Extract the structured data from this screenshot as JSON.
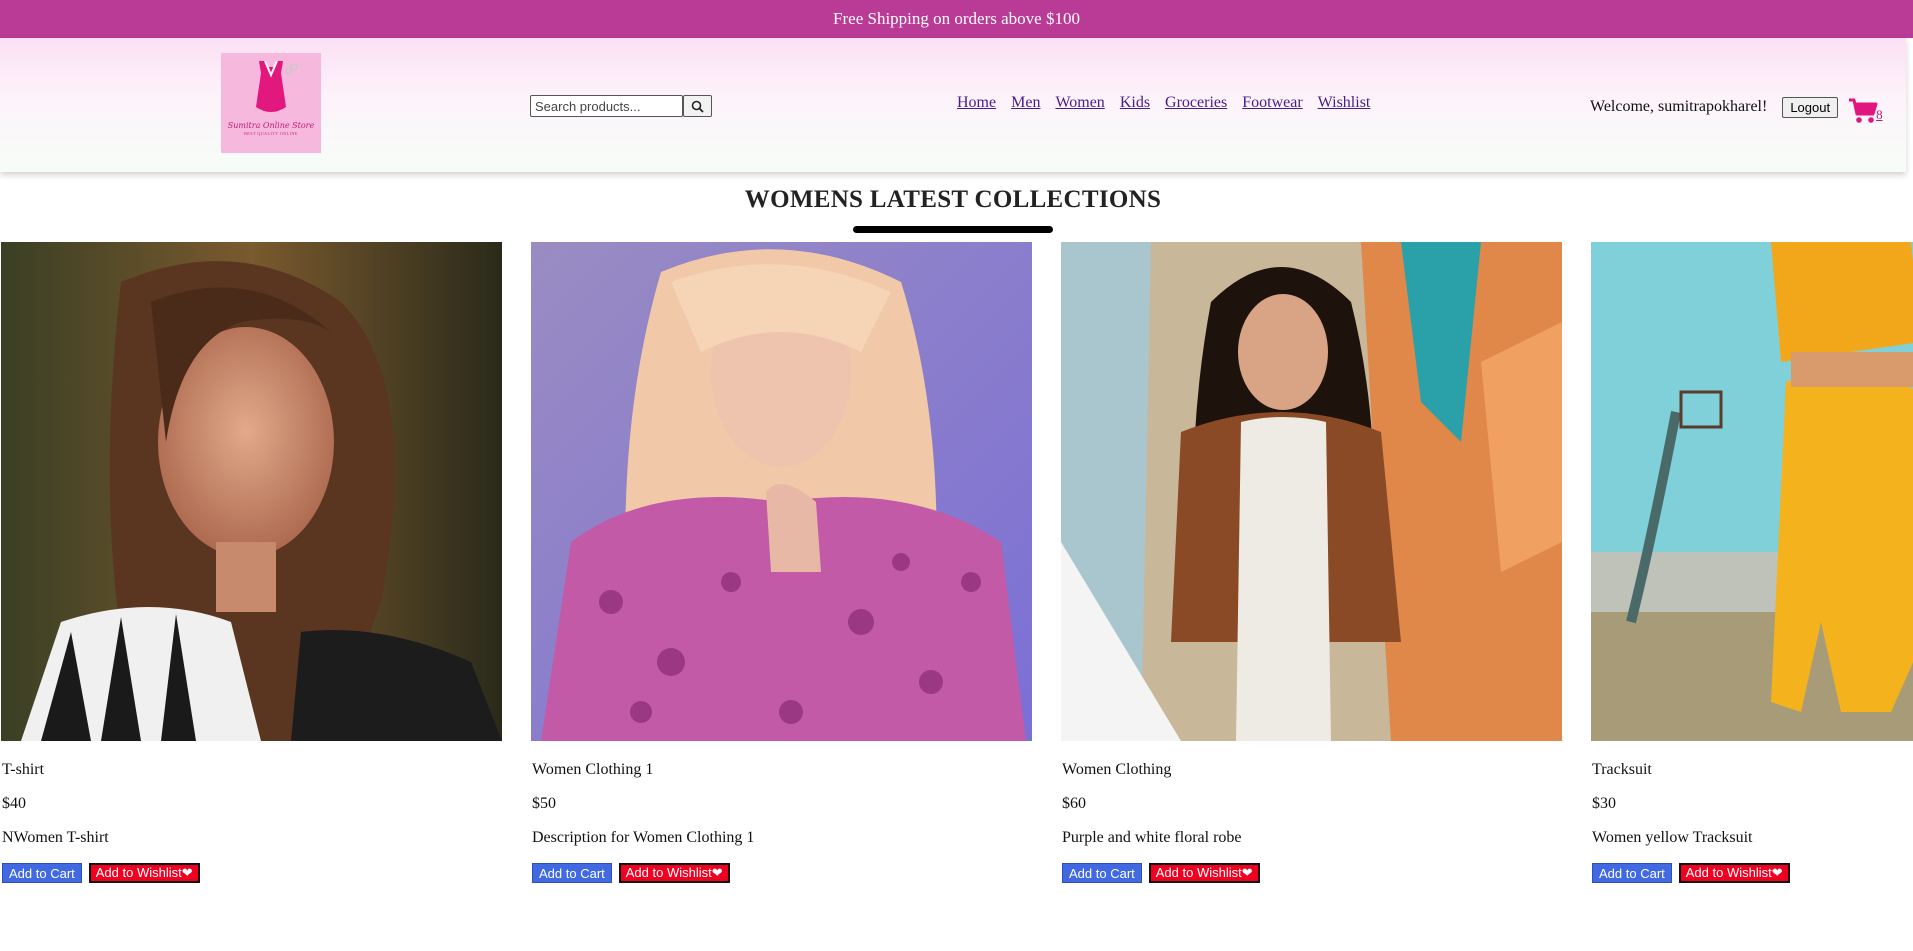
{
  "promo": {
    "text": "Free Shipping on orders above $100"
  },
  "logo": {
    "title": "Sumitra Online Store",
    "subtitle": "BEST QUALITY ONLINE"
  },
  "search": {
    "placeholder": "Search products..."
  },
  "nav": {
    "home": "Home",
    "men": "Men",
    "women": "Women",
    "kids": "Kids",
    "groceries": "Groceries",
    "footwear": "Footwear",
    "wishlist": "Wishlist"
  },
  "user": {
    "welcome": "Welcome, sumitrapokharel!",
    "logout_label": "Logout",
    "cart_count": "8"
  },
  "section": {
    "title": "WOMENS LATEST COLLECTIONS"
  },
  "products": [
    {
      "name": "T-shirt",
      "price": "$40",
      "desc": "NWomen T-shirt"
    },
    {
      "name": "Women Clothing 1",
      "price": "$50",
      "desc": "Description for Women Clothing 1"
    },
    {
      "name": "Women Clothing",
      "price": "$60",
      "desc": "Purple and white floral robe"
    },
    {
      "name": "Tracksuit",
      "price": "$30",
      "desc": "Women yellow Tracksuit"
    }
  ],
  "buttons": {
    "add_to_cart": "Add to Cart",
    "add_to_wishlist": "Add to Wishlist❤"
  },
  "colors": {
    "promo": "#b93b96",
    "cart_button": "#4169e1",
    "wishlist_button": "#f00020",
    "cart_icon": "#e0157f"
  },
  "icons": {
    "search": "search-icon",
    "cart": "shopping-cart-icon"
  }
}
